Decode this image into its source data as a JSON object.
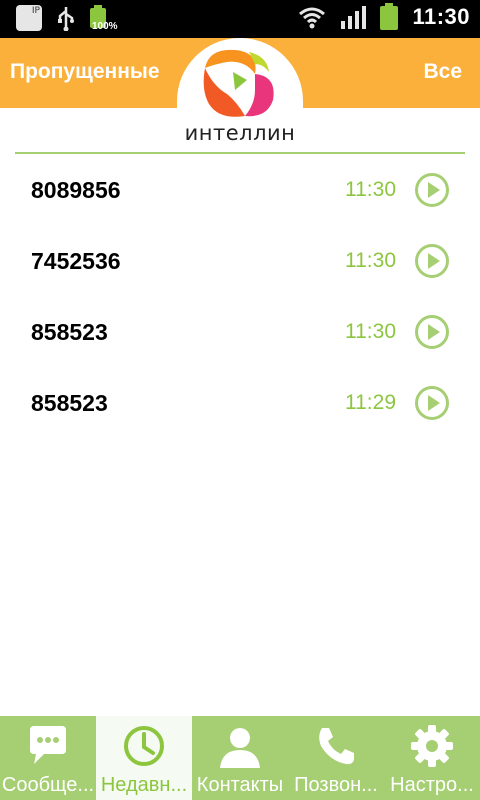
{
  "status_bar": {
    "ip_badge": "IP",
    "battery_percent": "100%",
    "time": "11:30",
    "icons": [
      "ip-icon",
      "usb-icon",
      "battery-icon",
      "wifi-icon",
      "signal-icon",
      "battery-icon"
    ]
  },
  "header": {
    "title": "Пропущенные",
    "filter_label": "Все",
    "logo_text": "интеллин"
  },
  "calls": [
    {
      "number": "8089856",
      "time": "11:30"
    },
    {
      "number": "7452536",
      "time": "11:30"
    },
    {
      "number": "858523",
      "time": "11:30"
    },
    {
      "number": "858523",
      "time": "11:29"
    }
  ],
  "bottom_nav": [
    {
      "label": "Сообще...",
      "icon": "message-icon",
      "active": false
    },
    {
      "label": "Недавн...",
      "icon": "clock-icon",
      "active": true
    },
    {
      "label": "Контакты",
      "icon": "contact-icon",
      "active": false
    },
    {
      "label": "Позвон...",
      "icon": "phone-icon",
      "active": false
    },
    {
      "label": "Настро...",
      "icon": "gear-icon",
      "active": false
    }
  ],
  "colors": {
    "header_bg": "#fbb03b",
    "accent_green": "#8cc63f",
    "nav_bg": "#a6cf73",
    "status_bg": "#000000"
  }
}
